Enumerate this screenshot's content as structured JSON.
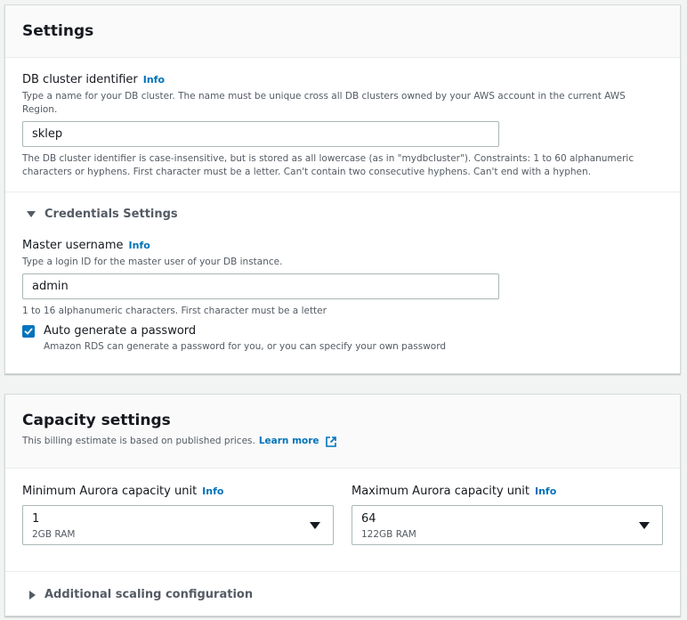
{
  "settings": {
    "title": "Settings",
    "cluster_id": {
      "label": "DB cluster identifier",
      "info": "Info",
      "description": "Type a name for your DB cluster. The name must be unique cross all DB clusters owned by your AWS account in the current AWS Region.",
      "value": "sklep",
      "constraints": "The DB cluster identifier is case-insensitive, but is stored as all lowercase (as in \"mydbcluster\"). Constraints: 1 to 60 alphanumeric characters or hyphens. First character must be a letter. Can't contain two consecutive hyphens. Can't end with a hyphen."
    },
    "credentials": {
      "title": "Credentials Settings",
      "expanded": true,
      "master_username": {
        "label": "Master username",
        "info": "Info",
        "description": "Type a login ID for the master user of your DB instance.",
        "value": "admin",
        "constraints": "1 to 16 alphanumeric characters. First character must be a letter"
      },
      "auto_password": {
        "label": "Auto generate a password",
        "checked": true,
        "description": "Amazon RDS can generate a password for you, or you can specify your own password"
      }
    }
  },
  "capacity": {
    "title": "Capacity settings",
    "subtitle": "This billing estimate is based on published prices.",
    "learn_more": "Learn more",
    "min": {
      "label": "Minimum Aurora capacity unit",
      "info": "Info",
      "value": "1",
      "sub": "2GB RAM"
    },
    "max": {
      "label": "Maximum Aurora capacity unit",
      "info": "Info",
      "value": "64",
      "sub": "122GB RAM"
    },
    "additional": {
      "title": "Additional scaling configuration",
      "expanded": false
    }
  },
  "colors": {
    "link": "#0073bb",
    "checkbox": "#0073bb",
    "background": "#f2f3f3"
  }
}
